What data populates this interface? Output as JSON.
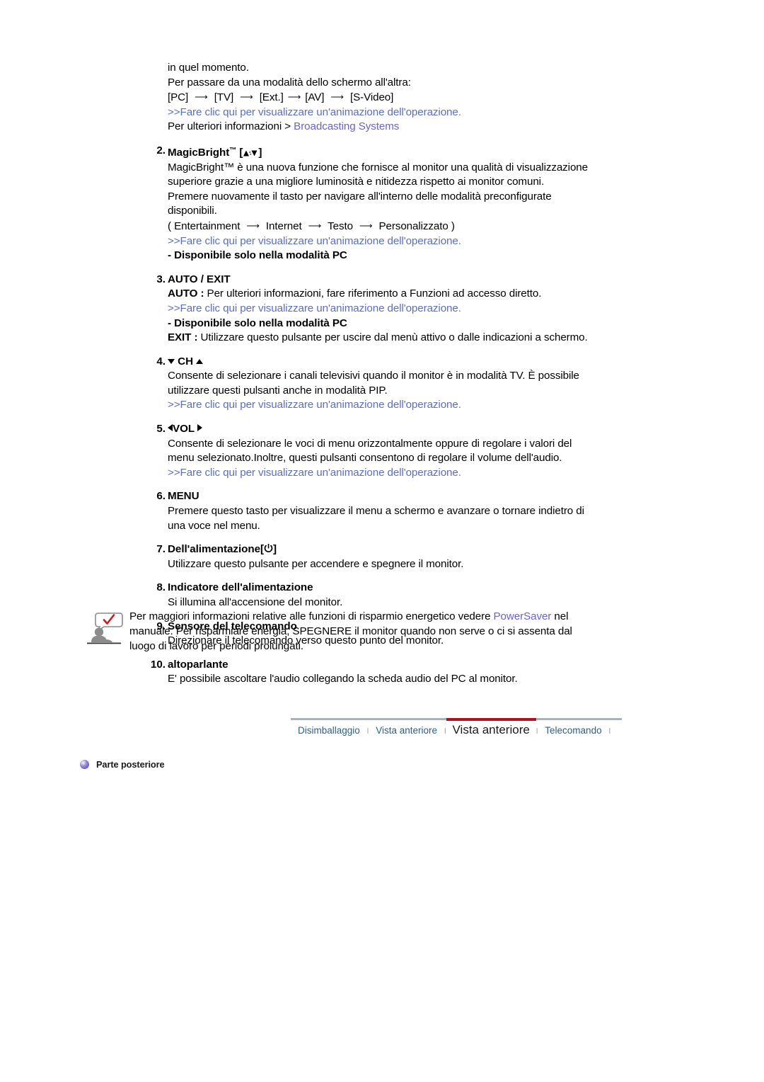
{
  "document": {
    "language": "it",
    "title": "Vista anteriore"
  },
  "intro": {
    "line1": "in quel momento.",
    "line2": "Per passare da una modalità dello schermo all'altra:",
    "mode_sequence": [
      "[PC]",
      "[TV]",
      "[Ext.]",
      "[AV]",
      "[S-Video]"
    ],
    "animation_link": ">>Fare clic qui per visualizzare un'animazione dell'operazione.",
    "more_info_prefix": "Per ulteriori informazioni > ",
    "more_info_link": "Broadcasting Systems"
  },
  "items": [
    {
      "number": "2.",
      "title": "MagicBright",
      "title_tm": "™",
      "title_icon": "brightness-icon",
      "body_lines": [
        "MagicBright™ è una nuova funzione che fornisce al monitor una qualità di visualizzazione",
        "superiore grazie a una migliore luminosità e nitidezza rispetto ai monitor comuni.",
        "Premere nuovamente il tasto per navigare all'interno delle modalità preconfigurate",
        "disponibili."
      ],
      "mode_sequence": [
        "( Entertainment",
        "Internet",
        "Testo",
        "Personalizzato )"
      ],
      "animation_link": ">>Fare clic qui per visualizzare un'animazione dell'operazione.",
      "note": "- Disponibile solo nella modalità PC"
    },
    {
      "number": "3.",
      "title": "AUTO / EXIT",
      "auto_label": "AUTO :",
      "auto_text": " Per ulteriori informazioni, fare riferimento a Funzioni ad accesso diretto.",
      "animation_link": ">>Fare clic qui per visualizzare un'animazione dell'operazione.",
      "note": "- Disponibile solo nella modalità PC",
      "exit_label": "EXIT :",
      "exit_text": " Utilizzare questo pulsante per uscire dal menù attivo o dalle indicazioni a schermo."
    },
    {
      "number": "4.",
      "title": "CH",
      "body_lines": [
        "Consente di selezionare i canali televisivi quando il monitor è in modalità TV. È possibile",
        "utilizzare questi pulsanti anche in modalità PIP."
      ],
      "animation_link": ">>Fare clic qui per visualizzare un'animazione dell'operazione."
    },
    {
      "number": "5.",
      "title": "VOL",
      "body_lines": [
        "Consente di selezionare le voci di menu orizzontalmente oppure di regolare i valori del",
        "menu selezionato.Inoltre, questi pulsanti consentono di regolare il volume dell'audio."
      ],
      "animation_link": ">>Fare clic qui per visualizzare un'animazione dell'operazione."
    },
    {
      "number": "6.",
      "title": "MENU",
      "body_lines": [
        "Premere questo tasto per visualizzare il menu a schermo e avanzare o tornare indietro di",
        "una voce nel menu."
      ]
    },
    {
      "number": "7.",
      "title": "Dell'alimentazione[",
      "title_suffix": "]",
      "title_icon": "power-icon",
      "body_lines": [
        "Utilizzare questo pulsante per accendere e spegnere il monitor."
      ]
    },
    {
      "number": "8.",
      "title": "Indicatore dell'alimentazione",
      "body_lines": [
        "Si illumina all'accensione del monitor."
      ]
    },
    {
      "number": "9.",
      "title": "Sensore del telecomando",
      "body_lines": [
        "Direzionare il telecomando verso questo punto del monitor."
      ]
    },
    {
      "number": "10.",
      "title": "altoparlante",
      "body_lines": [
        "E' possibile ascoltare l'audio collegando la scheda audio del PC al monitor."
      ]
    }
  ],
  "note_box": {
    "icon": "note-person-checkmark-icon",
    "line1_pre": "Per maggiori informazioni relative alle funzioni di risparmio energetico vedere ",
    "line1_link": "PowerSaver",
    "line1_post": " nel",
    "line2": "manuale. Per risparmiare energia, SPEGNERE il monitor quando non serve o ci si assenta dal",
    "line3": "luogo di lavoro per periodi prolungati."
  },
  "tabbar": {
    "tabs": [
      {
        "label": "Disimballaggio",
        "active": false
      },
      {
        "label": "Vista anteriore",
        "active": false
      },
      {
        "label": "Vista anteriore",
        "active": true
      },
      {
        "label": "Telecomando",
        "active": false
      }
    ],
    "separator": "l",
    "active_underline_color": "#b01020",
    "rule_color": "#a8b2bb",
    "link_color": "#2a6282"
  },
  "section_link": {
    "bullet_icon": "purple-sphere-bullet-icon",
    "label": "Parte posteriore"
  }
}
